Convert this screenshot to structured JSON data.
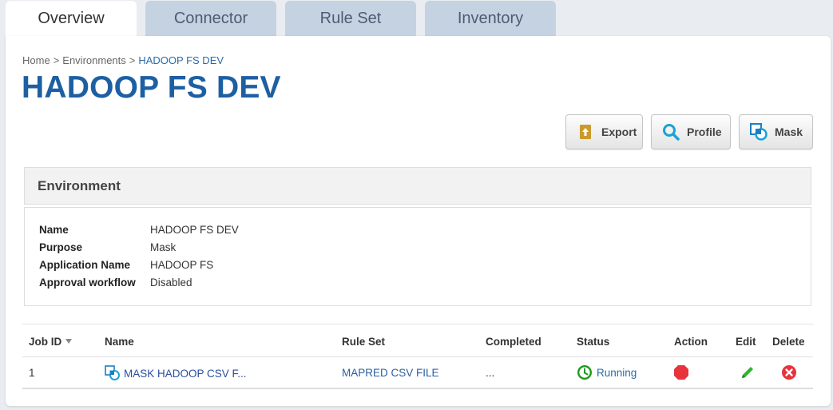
{
  "tabs": [
    {
      "label": "Overview",
      "active": true
    },
    {
      "label": "Connector",
      "active": false
    },
    {
      "label": "Rule Set",
      "active": false
    },
    {
      "label": "Inventory",
      "active": false
    }
  ],
  "breadcrumb": {
    "home": "Home",
    "sep1": ">",
    "environments": "Environments",
    "sep2": ">",
    "current": "HADOOP FS DEV"
  },
  "page_title": "HADOOP FS DEV",
  "toolbar": {
    "export_label": "Export",
    "profile_label": "Profile",
    "mask_label": "Mask"
  },
  "environment": {
    "header": "Environment",
    "fields": [
      {
        "key": "Name",
        "value": "HADOOP FS DEV"
      },
      {
        "key": "Purpose",
        "value": "Mask"
      },
      {
        "key": "Application Name",
        "value": "HADOOP FS"
      },
      {
        "key": "Approval workflow",
        "value": "Disabled"
      }
    ]
  },
  "jobs_table": {
    "columns": {
      "job_id": "Job ID",
      "name": "Name",
      "rule_set": "Rule Set",
      "completed": "Completed",
      "status": "Status",
      "action": "Action",
      "edit": "Edit",
      "delete": "Delete"
    },
    "rows": [
      {
        "job_id": "1",
        "name": "MASK HADOOP CSV F...",
        "rule_set": "MAPRED CSV FILE",
        "completed": "...",
        "status": "Running"
      }
    ]
  },
  "colors": {
    "title_blue": "#1d5fa3",
    "link_blue": "#2a6aa8",
    "tab_inactive": "#c5d2e2",
    "status_green": "#1d9a1d",
    "stop_red": "#e8323c",
    "edit_green": "#2fb52f",
    "delete_red": "#e8323c"
  }
}
